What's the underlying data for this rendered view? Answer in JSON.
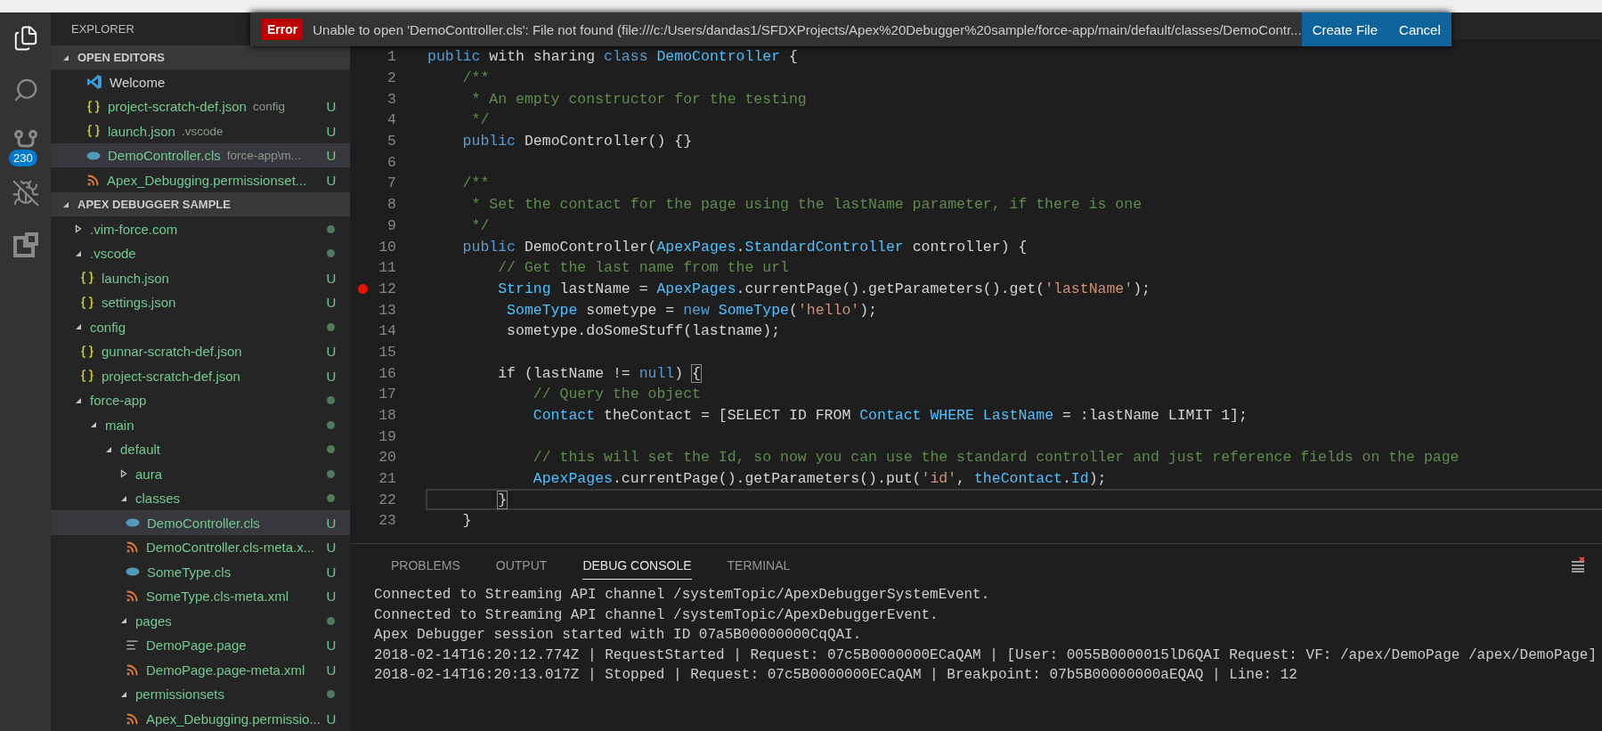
{
  "activity_bar": [
    {
      "kind": "files",
      "selected": true
    },
    {
      "kind": "search",
      "selected": false
    },
    {
      "kind": "source-control",
      "badge": "230",
      "selected": false
    },
    {
      "kind": "debug",
      "selected": false
    },
    {
      "kind": "extensions",
      "selected": false
    }
  ],
  "notification": {
    "severity": "Error",
    "message": "Unable to open 'DemoController.cls': File not found (file:///c:/Users/dandas1/SFDXProjects/Apex%20Debugger%20sample/force-app/main/default/classes/DemoContr...",
    "actions": [
      "Create File",
      "Cancel"
    ]
  },
  "sidebar": {
    "title": "EXPLORER",
    "open_editors": {
      "title": "OPEN EDITORS",
      "expanded": true,
      "items": [
        {
          "kind": "welcome",
          "name": "Welcome",
          "selected": false
        },
        {
          "kind": "json",
          "name": "project-scratch-def.json",
          "description": "config",
          "status": "U",
          "selected": false
        },
        {
          "kind": "json",
          "name": "launch.json",
          "description": ".vscode",
          "status": "U",
          "selected": false
        },
        {
          "kind": "class",
          "name": "DemoController.cls",
          "description": "force-app\\m...",
          "status": "U",
          "selected": true
        },
        {
          "kind": "xml",
          "name": "Apex_Debugging.permissionset...",
          "status": "U",
          "selected": false
        }
      ]
    },
    "project": {
      "title": "APEX DEBUGGER SAMPLE",
      "expanded": true,
      "tree": [
        {
          "kind": "folder",
          "name": ".vim-force.com",
          "expanded": false,
          "selected": false
        },
        {
          "kind": "folder",
          "name": ".vscode",
          "expanded": true,
          "selected": false,
          "children": [
            {
              "kind": "json",
              "name": "launch.json",
              "status": "U",
              "selected": false
            },
            {
              "kind": "json",
              "name": "settings.json",
              "status": "U",
              "selected": false
            }
          ]
        },
        {
          "kind": "folder",
          "name": "config",
          "expanded": true,
          "selected": false,
          "children": [
            {
              "kind": "json",
              "name": "gunnar-scratch-def.json",
              "status": "U",
              "selected": false
            },
            {
              "kind": "json",
              "name": "project-scratch-def.json",
              "status": "U",
              "selected": false
            }
          ]
        },
        {
          "kind": "folder",
          "name": "force-app",
          "expanded": true,
          "selected": false,
          "children": [
            {
              "kind": "folder",
              "name": "main",
              "expanded": true,
              "selected": false,
              "children": [
                {
                  "kind": "folder",
                  "name": "default",
                  "expanded": true,
                  "selected": false,
                  "children": [
                    {
                      "kind": "folder",
                      "name": "aura",
                      "expanded": false,
                      "selected": false
                    },
                    {
                      "kind": "folder",
                      "name": "classes",
                      "expanded": true,
                      "selected": false,
                      "children": [
                        {
                          "kind": "class",
                          "name": "DemoController.cls",
                          "status": "U",
                          "selected": true
                        },
                        {
                          "kind": "xml",
                          "name": "DemoController.cls-meta.x...",
                          "status": "U",
                          "selected": false
                        },
                        {
                          "kind": "class",
                          "name": "SomeType.cls",
                          "status": "U",
                          "selected": false
                        },
                        {
                          "kind": "xml",
                          "name": "SomeType.cls-meta.xml",
                          "status": "U",
                          "selected": false
                        }
                      ]
                    },
                    {
                      "kind": "folder",
                      "name": "pages",
                      "expanded": true,
                      "selected": false,
                      "children": [
                        {
                          "kind": "page",
                          "name": "DemoPage.page",
                          "status": "U",
                          "selected": false
                        },
                        {
                          "kind": "xml",
                          "name": "DemoPage.page-meta.xml",
                          "status": "U",
                          "selected": false
                        }
                      ]
                    },
                    {
                      "kind": "folder",
                      "name": "permissionsets",
                      "expanded": true,
                      "selected": false,
                      "children": [
                        {
                          "kind": "xml",
                          "name": "Apex_Debugging.permissio...",
                          "status": "U",
                          "selected": false
                        }
                      ]
                    }
                  ]
                }
              ]
            }
          ]
        }
      ]
    }
  },
  "editor": {
    "lines": [
      {
        "number": "1",
        "breakpoint": false,
        "cursor_line": false,
        "tokens": [
          {
            "kind": "keyword",
            "text": "public"
          },
          {
            "kind": "plain",
            "text": " with sharing "
          },
          {
            "kind": "keyword",
            "text": "class "
          },
          {
            "kind": "type",
            "text": "DemoController"
          },
          {
            "kind": "plain",
            "text": " {"
          }
        ]
      },
      {
        "number": "2",
        "breakpoint": false,
        "cursor_line": false,
        "tokens": [
          {
            "kind": "comment",
            "text": "    /**"
          }
        ]
      },
      {
        "number": "3",
        "breakpoint": false,
        "cursor_line": false,
        "tokens": [
          {
            "kind": "comment",
            "text": "     * An empty constructor for the testing"
          }
        ]
      },
      {
        "number": "4",
        "breakpoint": false,
        "cursor_line": false,
        "tokens": [
          {
            "kind": "comment",
            "text": "     */"
          }
        ]
      },
      {
        "number": "5",
        "breakpoint": false,
        "cursor_line": false,
        "tokens": [
          {
            "kind": "keyword",
            "text": "    public"
          },
          {
            "kind": "plain",
            "text": " DemoController() {}"
          }
        ]
      },
      {
        "number": "6",
        "breakpoint": false,
        "cursor_line": false
      },
      {
        "number": "7",
        "breakpoint": false,
        "cursor_line": false,
        "tokens": [
          {
            "kind": "comment",
            "text": "    /**"
          }
        ]
      },
      {
        "number": "8",
        "breakpoint": false,
        "cursor_line": false,
        "tokens": [
          {
            "kind": "comment",
            "text": "     * Set the contact for the page using the lastName parameter, if there is one"
          }
        ]
      },
      {
        "number": "9",
        "breakpoint": false,
        "cursor_line": false,
        "tokens": [
          {
            "kind": "comment",
            "text": "     */"
          }
        ]
      },
      {
        "number": "10",
        "breakpoint": false,
        "cursor_line": false,
        "tokens": [
          {
            "kind": "keyword",
            "text": "    public"
          },
          {
            "kind": "plain",
            "text": " DemoController("
          },
          {
            "kind": "type",
            "text": "ApexPages"
          },
          {
            "kind": "plain",
            "text": "."
          },
          {
            "kind": "type",
            "text": "StandardController"
          },
          {
            "kind": "plain",
            "text": " controller) {"
          }
        ]
      },
      {
        "number": "11",
        "breakpoint": false,
        "cursor_line": false,
        "tokens": [
          {
            "kind": "comment",
            "text": "        // Get the last name from the url"
          }
        ]
      },
      {
        "number": "12",
        "breakpoint": true,
        "cursor_line": false,
        "tokens": [
          {
            "kind": "type",
            "text": "        String"
          },
          {
            "kind": "plain",
            "text": " lastName = "
          },
          {
            "kind": "type",
            "text": "ApexPages"
          },
          {
            "kind": "plain",
            "text": ".currentPage().getParameters().get("
          },
          {
            "kind": "string",
            "text": "'lastName'"
          },
          {
            "kind": "plain",
            "text": ");"
          }
        ]
      },
      {
        "number": "13",
        "breakpoint": false,
        "cursor_line": false,
        "tokens": [
          {
            "kind": "type",
            "text": "         SomeType"
          },
          {
            "kind": "plain",
            "text": " sometype = "
          },
          {
            "kind": "keyword",
            "text": "new "
          },
          {
            "kind": "type",
            "text": "SomeType"
          },
          {
            "kind": "plain",
            "text": "("
          },
          {
            "kind": "string",
            "text": "'hello'"
          },
          {
            "kind": "plain",
            "text": ");"
          }
        ]
      },
      {
        "number": "14",
        "breakpoint": false,
        "cursor_line": false,
        "tokens": [
          {
            "kind": "plain",
            "text": "         sometype.doSomeStuff(lastname);"
          }
        ]
      },
      {
        "number": "15",
        "breakpoint": false,
        "cursor_line": false
      },
      {
        "number": "16",
        "breakpoint": false,
        "cursor_line": false,
        "tokens": [
          {
            "kind": "plain",
            "text": "        if (lastName != "
          },
          {
            "kind": "keyword",
            "text": "null"
          },
          {
            "kind": "plain",
            "text": ") "
          },
          {
            "kind": "bracket",
            "text": "{"
          }
        ]
      },
      {
        "number": "17",
        "breakpoint": false,
        "cursor_line": false,
        "tokens": [
          {
            "kind": "comment",
            "text": "            // Query the object"
          }
        ]
      },
      {
        "number": "18",
        "breakpoint": false,
        "cursor_line": false,
        "tokens": [
          {
            "kind": "type",
            "text": "            Contact"
          },
          {
            "kind": "plain",
            "text": " theContact = [SELECT ID FROM "
          },
          {
            "kind": "type",
            "text": "Contact WHERE LastName"
          },
          {
            "kind": "plain",
            "text": " = :lastName LIMIT 1];"
          }
        ]
      },
      {
        "number": "19",
        "breakpoint": false,
        "cursor_line": false
      },
      {
        "number": "20",
        "breakpoint": false,
        "cursor_line": false,
        "tokens": [
          {
            "kind": "comment",
            "text": "            // this will set the Id, so now you can use the standard controller and just reference fields on the page"
          }
        ]
      },
      {
        "number": "21",
        "breakpoint": false,
        "cursor_line": false,
        "tokens": [
          {
            "kind": "type",
            "text": "            ApexPages"
          },
          {
            "kind": "plain",
            "text": ".currentPage().getParameters().put("
          },
          {
            "kind": "string",
            "text": "'id'"
          },
          {
            "kind": "plain",
            "text": ", "
          },
          {
            "kind": "type",
            "text": "theContact"
          },
          {
            "kind": "plain",
            "text": "."
          },
          {
            "kind": "type",
            "text": "Id"
          },
          {
            "kind": "plain",
            "text": ");"
          }
        ]
      },
      {
        "number": "22",
        "breakpoint": false,
        "cursor_line": true,
        "tokens": [
          {
            "kind": "bracket",
            "text": "        }"
          }
        ]
      },
      {
        "number": "23",
        "breakpoint": false,
        "cursor_line": false,
        "tokens": [
          {
            "kind": "plain",
            "text": "    }"
          }
        ]
      }
    ]
  },
  "panel": {
    "tabs": [
      {
        "label": "PROBLEMS",
        "selected": false
      },
      {
        "label": "OUTPUT",
        "selected": false
      },
      {
        "label": "DEBUG CONSOLE",
        "selected": true
      },
      {
        "label": "TERMINAL",
        "selected": false
      }
    ],
    "console_lines": [
      "Connected to Streaming API channel /systemTopic/ApexDebuggerSystemEvent.",
      "Connected to Streaming API channel /systemTopic/ApexDebuggerEvent.",
      "Apex Debugger session started with ID 07a5B00000000CqQAI.",
      "2018-02-14T16:20:12.774Z | RequestStarted | Request: 07c5B0000000ECaQAM | [User: 0055B0000015lD6QAI Request: VF: /apex/DemoPage /apex/DemoPage]",
      "2018-02-14T16:20:13.017Z | Stopped | Request: 07c5B0000000ECaQAM | Breakpoint: 07b5B00000000aEQAQ | Line: 12"
    ]
  }
}
